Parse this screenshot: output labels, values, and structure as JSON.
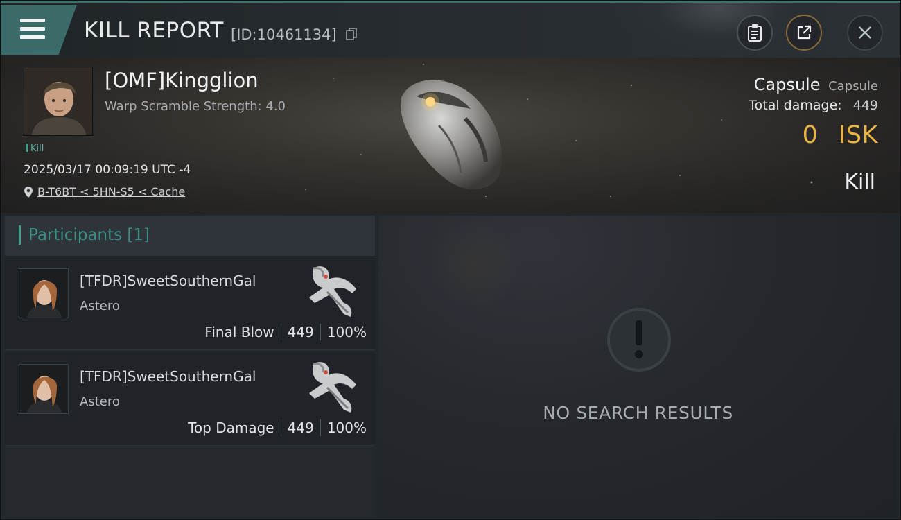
{
  "header": {
    "title": "KILL REPORT",
    "report_id": "[ID:10461134]",
    "icons": [
      "menu-icon",
      "copy-icon",
      "clipboard-icon",
      "share-icon",
      "close-icon"
    ]
  },
  "victim": {
    "name": "[OMF]Kingglion",
    "subtitle": "Warp Scramble Strength: 4.0",
    "tag": "Kill",
    "timestamp": "2025/03/17 00:09:19 UTC -4",
    "location": "B-T6BT < 5HN-S5 < Cache",
    "ship_name": "Capsule",
    "ship_class": "Capsule",
    "damage_label": "Total damage:",
    "damage_value": "449",
    "isk_value": "0",
    "isk_unit": "ISK",
    "result": "Kill"
  },
  "participants": {
    "heading": "Participants",
    "count": "[1]",
    "rows": [
      {
        "name": "[TFDR]SweetSouthernGal",
        "ship": "Astero",
        "role": "Final Blow",
        "damage": "449",
        "percent": "100%"
      },
      {
        "name": "[TFDR]SweetSouthernGal",
        "ship": "Astero",
        "role": "Top Damage",
        "damage": "449",
        "percent": "100%"
      }
    ]
  },
  "results": {
    "empty_text": "NO SEARCH RESULTS"
  },
  "colors": {
    "accent": "#3f9d8c",
    "menu": "#3b6b68",
    "isk": "#e8b446"
  }
}
